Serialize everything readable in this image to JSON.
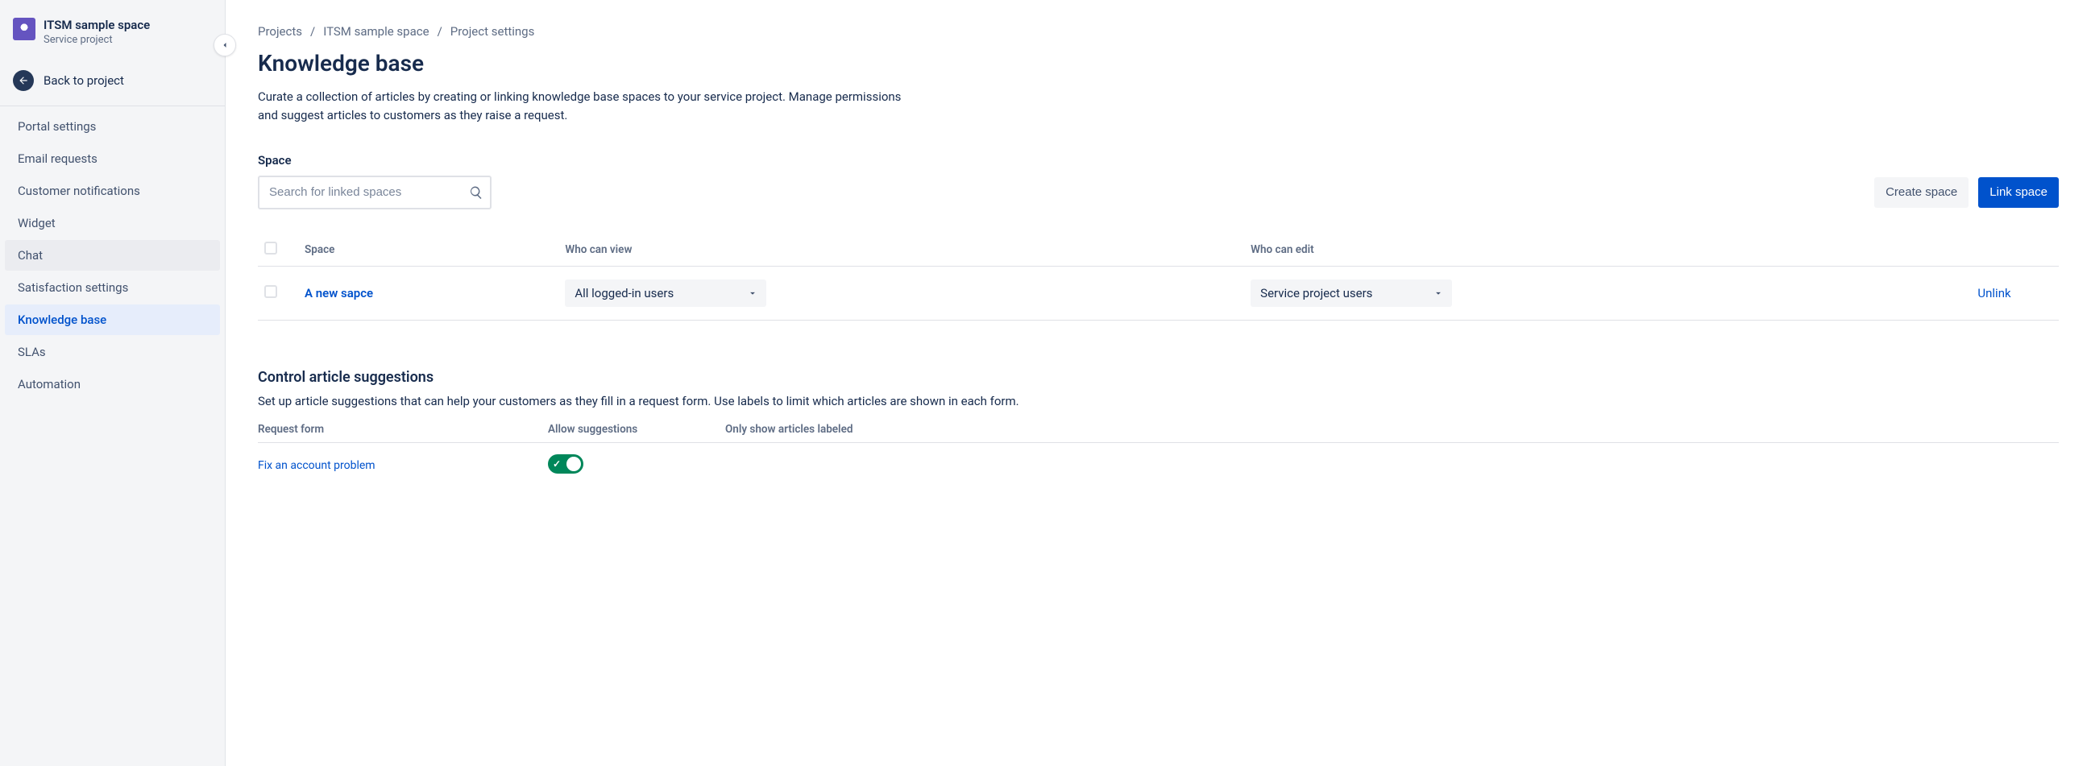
{
  "project": {
    "name": "ITSM sample space",
    "subtitle": "Service project",
    "back_label": "Back to project"
  },
  "sidebar": {
    "items": [
      {
        "label": "Portal settings",
        "state": ""
      },
      {
        "label": "Email requests",
        "state": ""
      },
      {
        "label": "Customer notifications",
        "state": ""
      },
      {
        "label": "Widget",
        "state": ""
      },
      {
        "label": "Chat",
        "state": "hover"
      },
      {
        "label": "Satisfaction settings",
        "state": ""
      },
      {
        "label": "Knowledge base",
        "state": "active"
      },
      {
        "label": "SLAs",
        "state": ""
      },
      {
        "label": "Automation",
        "state": ""
      }
    ]
  },
  "breadcrumb": [
    "Projects",
    "ITSM sample space",
    "Project settings"
  ],
  "page": {
    "title": "Knowledge base",
    "description": "Curate a collection of articles by creating or linking knowledge base spaces to your service project. Manage permissions and suggest articles to customers as they raise a request."
  },
  "space": {
    "label": "Space",
    "search_placeholder": "Search for linked spaces",
    "create_label": "Create space",
    "link_label": "Link space",
    "columns": [
      "Space",
      "Who can view",
      "Who can edit"
    ],
    "rows": [
      {
        "name": "A new sapce",
        "view": "All logged-in users",
        "edit": "Service project users",
        "action": "Unlink"
      }
    ]
  },
  "suggestions": {
    "title": "Control article suggestions",
    "desc": "Set up article suggestions that can help your customers as they fill in a request form. Use labels to limit which articles are shown in each form.",
    "columns": [
      "Request form",
      "Allow suggestions",
      "Only show articles labeled"
    ],
    "rows": [
      {
        "form": "Fix an account problem",
        "allow": true
      }
    ]
  }
}
